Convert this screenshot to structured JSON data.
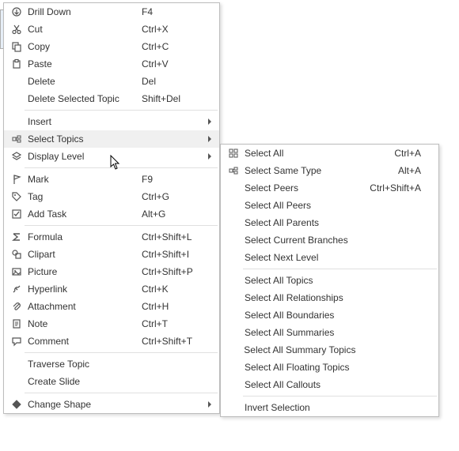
{
  "main_menu": {
    "groups": [
      [
        {
          "key": "drill-down",
          "label": "Drill Down",
          "shortcut": "F4",
          "icon": "circle-arrow"
        },
        {
          "key": "cut",
          "label": "Cut",
          "shortcut": "Ctrl+X",
          "icon": "cut"
        },
        {
          "key": "copy",
          "label": "Copy",
          "shortcut": "Ctrl+C",
          "icon": "copy"
        },
        {
          "key": "paste",
          "label": "Paste",
          "shortcut": "Ctrl+V",
          "icon": "paste"
        },
        {
          "key": "delete",
          "label": "Delete",
          "shortcut": "Del",
          "icon": ""
        },
        {
          "key": "delete-selected",
          "label": "Delete Selected Topic",
          "shortcut": "Shift+Del",
          "icon": ""
        }
      ],
      [
        {
          "key": "insert",
          "label": "Insert",
          "shortcut": "",
          "icon": "",
          "submenu": true
        },
        {
          "key": "select-topics",
          "label": "Select Topics",
          "shortcut": "",
          "icon": "select",
          "submenu": true,
          "highlight": true
        },
        {
          "key": "display-level",
          "label": "Display Level",
          "shortcut": "",
          "icon": "layers",
          "submenu": true
        }
      ],
      [
        {
          "key": "mark",
          "label": "Mark",
          "shortcut": "F9",
          "icon": "flag"
        },
        {
          "key": "tag",
          "label": "Tag",
          "shortcut": "Ctrl+G",
          "icon": "tag"
        },
        {
          "key": "add-task",
          "label": "Add Task",
          "shortcut": "Alt+G",
          "icon": "task"
        }
      ],
      [
        {
          "key": "formula",
          "label": "Formula",
          "shortcut": "Ctrl+Shift+L",
          "icon": "sigma"
        },
        {
          "key": "clipart",
          "label": "Clipart",
          "shortcut": "Ctrl+Shift+I",
          "icon": "clipart"
        },
        {
          "key": "picture",
          "label": "Picture",
          "shortcut": "Ctrl+Shift+P",
          "icon": "picture"
        },
        {
          "key": "hyperlink",
          "label": "Hyperlink",
          "shortcut": "Ctrl+K",
          "icon": "link"
        },
        {
          "key": "attachment",
          "label": "Attachment",
          "shortcut": "Ctrl+H",
          "icon": "attach"
        },
        {
          "key": "note",
          "label": "Note",
          "shortcut": "Ctrl+T",
          "icon": "note"
        },
        {
          "key": "comment",
          "label": "Comment",
          "shortcut": "Ctrl+Shift+T",
          "icon": "comment"
        }
      ],
      [
        {
          "key": "traverse",
          "label": "Traverse Topic",
          "shortcut": "",
          "icon": ""
        },
        {
          "key": "create-slide",
          "label": "Create Slide",
          "shortcut": "",
          "icon": ""
        }
      ],
      [
        {
          "key": "change-shape",
          "label": "Change Shape",
          "shortcut": "",
          "icon": "shape",
          "submenu": true
        }
      ]
    ]
  },
  "sub_menu": {
    "groups": [
      [
        {
          "key": "select-all",
          "label": "Select All",
          "shortcut": "Ctrl+A",
          "icon": "sel-all"
        },
        {
          "key": "select-same-type",
          "label": "Select Same Type",
          "shortcut": "Alt+A",
          "icon": "sel-type"
        },
        {
          "key": "select-peers",
          "label": "Select Peers",
          "shortcut": "Ctrl+Shift+A",
          "icon": ""
        },
        {
          "key": "select-all-peers",
          "label": "Select All Peers",
          "shortcut": "",
          "icon": ""
        },
        {
          "key": "select-all-parents",
          "label": "Select All Parents",
          "shortcut": "",
          "icon": ""
        },
        {
          "key": "select-current-branches",
          "label": "Select Current Branches",
          "shortcut": "",
          "icon": ""
        },
        {
          "key": "select-next-level",
          "label": "Select Next Level",
          "shortcut": "",
          "icon": ""
        }
      ],
      [
        {
          "key": "select-all-topics",
          "label": "Select All Topics",
          "shortcut": "",
          "icon": ""
        },
        {
          "key": "select-all-relationships",
          "label": "Select All Relationships",
          "shortcut": "",
          "icon": ""
        },
        {
          "key": "select-all-boundaries",
          "label": "Select All Boundaries",
          "shortcut": "",
          "icon": ""
        },
        {
          "key": "select-all-summaries",
          "label": "Select All Summaries",
          "shortcut": "",
          "icon": ""
        },
        {
          "key": "select-all-summary-topics",
          "label": "Select All Summary Topics",
          "shortcut": "",
          "icon": ""
        },
        {
          "key": "select-all-floating",
          "label": "Select All Floating Topics",
          "shortcut": "",
          "icon": ""
        },
        {
          "key": "select-all-callouts",
          "label": "Select All Callouts",
          "shortcut": "",
          "icon": ""
        }
      ],
      [
        {
          "key": "invert-selection",
          "label": "Invert Selection",
          "shortcut": "",
          "icon": ""
        }
      ]
    ]
  }
}
